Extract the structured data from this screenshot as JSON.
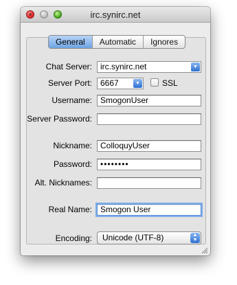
{
  "window": {
    "title": "irc.synirc.net"
  },
  "tabs": [
    {
      "label": "General",
      "active": true
    },
    {
      "label": "Automatic",
      "active": false
    },
    {
      "label": "Ignores",
      "active": false
    }
  ],
  "form": {
    "chat_server": {
      "label": "Chat Server:",
      "value": "irc.synirc.net"
    },
    "server_port": {
      "label": "Server Port:",
      "value": "6667"
    },
    "ssl": {
      "label": "SSL",
      "checked": false
    },
    "username": {
      "label": "Username:",
      "value": "SmogonUser"
    },
    "server_password": {
      "label": "Server Password:",
      "value": ""
    },
    "nickname": {
      "label": "Nickname:",
      "value": "ColloquyUser"
    },
    "password": {
      "label": "Password:",
      "value": "••••••••"
    },
    "alt_nicknames": {
      "label": "Alt. Nicknames:",
      "value": ""
    },
    "real_name": {
      "label": "Real Name:",
      "value": "Smogon User"
    },
    "encoding": {
      "label": "Encoding:",
      "value": "Unicode (UTF-8)"
    }
  },
  "icons": {
    "dropdown": "chevron-down-icon",
    "popup": "up-down-arrows-icon",
    "resize": "resize-grip-icon"
  },
  "colors": {
    "accent": "#3d7fd6",
    "close": "#d82323",
    "minimize": "#b7b7b7",
    "zoom": "#48a818"
  }
}
